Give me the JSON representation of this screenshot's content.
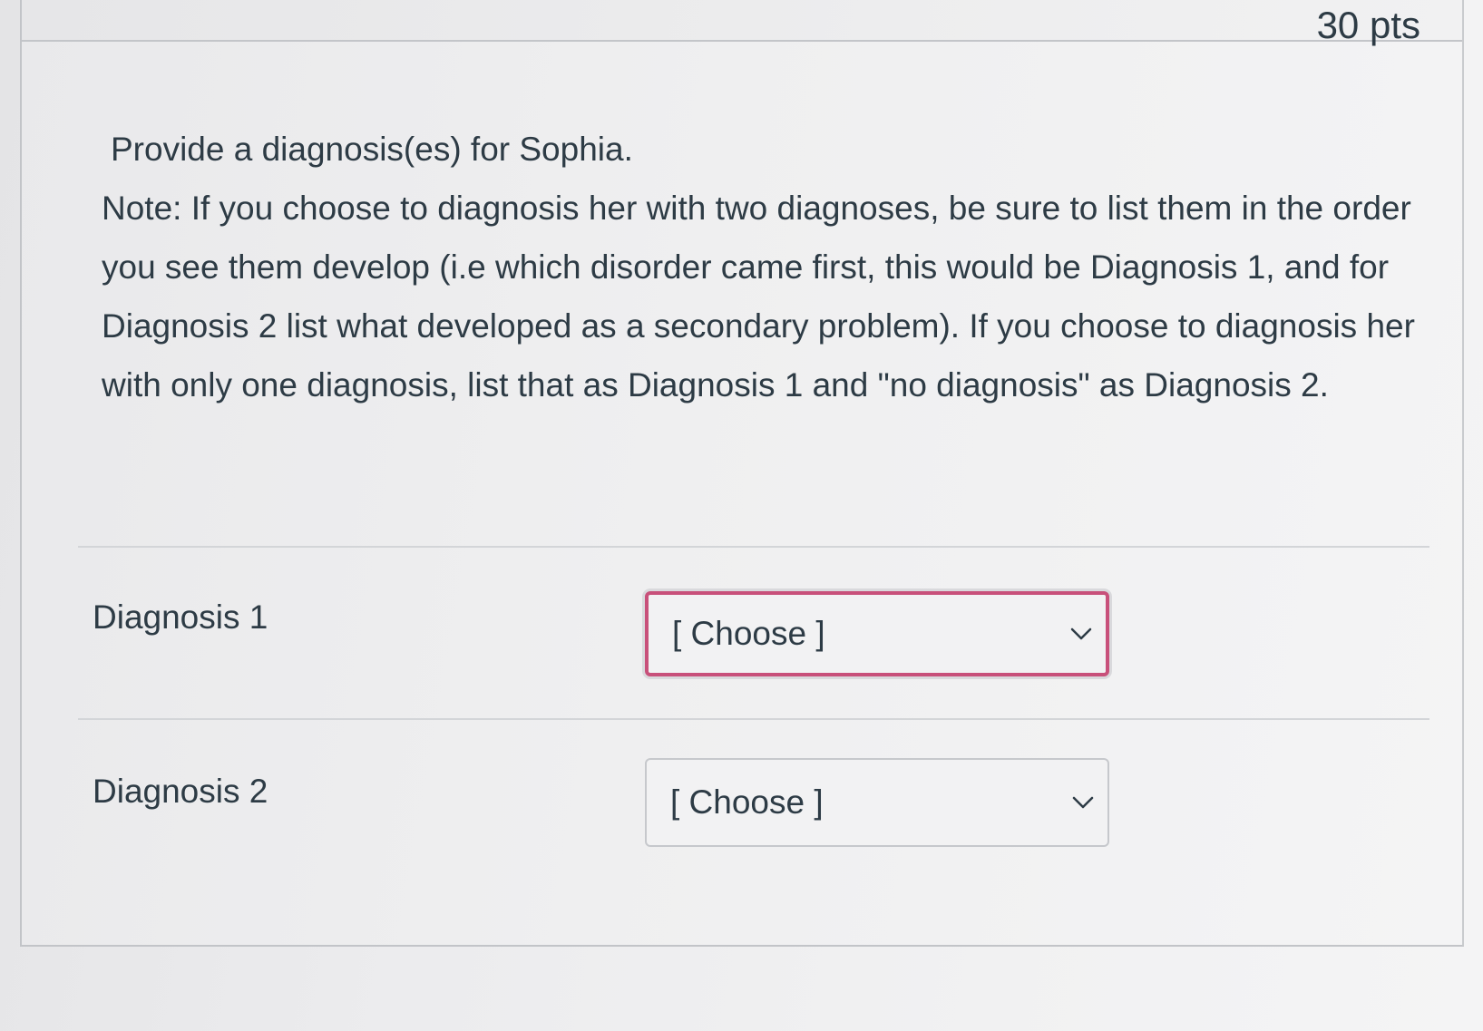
{
  "question": {
    "points": "30 pts",
    "prompt": "Provide a diagnosis(es) for Sophia.",
    "note": "Note: If you choose to diagnosis her with two diagnoses, be sure to list them in the order you see them develop (i.e which disorder came first, this would be Diagnosis 1, and for Diagnosis 2 list what developed as a secondary problem). If you choose to diagnosis her with only one diagnosis, list that as Diagnosis 1 and \"no diagnosis\" as Diagnosis 2."
  },
  "answers": [
    {
      "label": "Diagnosis 1",
      "selected": "[ Choose ]",
      "focused": true,
      "focus_color": "#c8507a"
    },
    {
      "label": "Diagnosis 2",
      "selected": "[ Choose ]",
      "focused": false
    }
  ],
  "icons": {
    "dropdown": "chevron-down-icon"
  }
}
